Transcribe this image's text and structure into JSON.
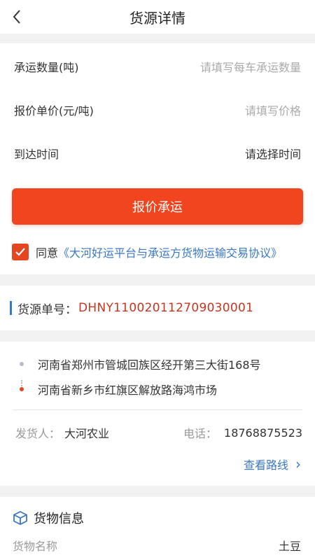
{
  "header": {
    "title": "货源详情"
  },
  "form": {
    "quantity": {
      "label": "承运数量(吨)",
      "placeholder": "请填写每车承运数量"
    },
    "price": {
      "label": "报价单价(元/吨)",
      "placeholder": "请填写价格"
    },
    "arrival": {
      "label": "到达时间",
      "value": "请选择时间"
    }
  },
  "actions": {
    "quote_label": "报价承运"
  },
  "agreement": {
    "checked": true,
    "prefix": "同意",
    "link": "《大河好运平台与承运方货物运输交易协议》"
  },
  "source": {
    "label": "货源单号：",
    "number": "DHNY110020112709030001"
  },
  "route": {
    "origin": "河南省郑州市管城回族区经开第三大街168号",
    "destination": "河南省新乡市红旗区解放路海鸿市场"
  },
  "shipper": {
    "label": "发货人：",
    "name": "大河农业",
    "phone_label": "电话：",
    "phone": "18768875523"
  },
  "view_route": {
    "label": "查看路线",
    "chevron": "›"
  },
  "goods": {
    "section_title": "货物信息",
    "name_label": "货物名称",
    "name_value": "土豆"
  },
  "colors": {
    "accent": "#f0451f",
    "link": "#3b78c2",
    "order": "#c9351e"
  },
  "icons": {
    "back": "chevron-left-icon",
    "check": "check-icon",
    "cube": "cube-icon"
  }
}
